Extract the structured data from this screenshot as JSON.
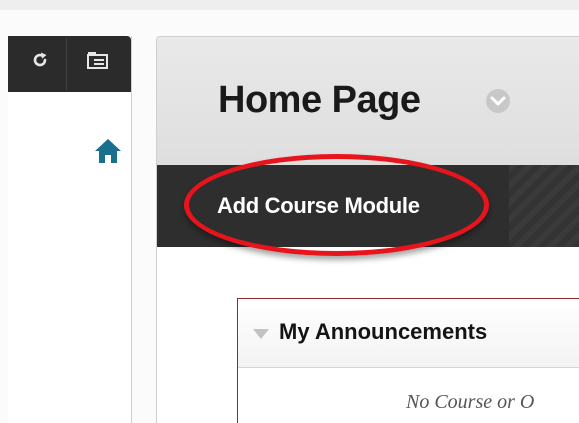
{
  "left_panel": {
    "toolbar": {
      "refresh_icon": "refresh-icon",
      "folder_icon": "folder-view-icon"
    },
    "home_icon": "home-icon",
    "home_icon_color": "#1a6e8e"
  },
  "page": {
    "title": "Home Page",
    "title_menu_icon": "chevron-down-icon"
  },
  "action_bar": {
    "add_module_label": "Add Course Module",
    "highlight_color": "#e8141c"
  },
  "module": {
    "title": "My Announcements",
    "body_text": "No Course or O",
    "border_color": "#8a2b2b"
  }
}
